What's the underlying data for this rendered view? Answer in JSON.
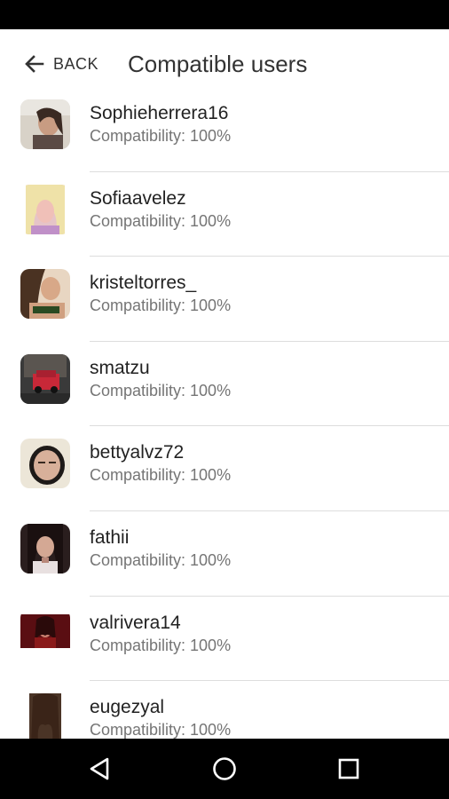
{
  "header": {
    "back_label": "BACK",
    "title": "Compatible users"
  },
  "users": [
    {
      "name": "Sophieherrera16",
      "compatibility": "Compatibility: 100%"
    },
    {
      "name": "Sofiaavelez",
      "compatibility": "Compatibility: 100%"
    },
    {
      "name": "kristeltorres_",
      "compatibility": "Compatibility: 100%"
    },
    {
      "name": "smatzu",
      "compatibility": "Compatibility: 100%"
    },
    {
      "name": "bettyalvz72",
      "compatibility": "Compatibility: 100%"
    },
    {
      "name": "fathii",
      "compatibility": "Compatibility: 100%"
    },
    {
      "name": "valrivera14",
      "compatibility": "Compatibility: 100%"
    },
    {
      "name": "eugezyal",
      "compatibility": "Compatibility: 100%"
    }
  ],
  "nav": {
    "back_icon": "triangle-back-icon",
    "home_icon": "circle-home-icon",
    "recents_icon": "square-recents-icon"
  },
  "colors": {
    "status_bar": "#000000",
    "nav_bar": "#000000",
    "text_primary": "#222222",
    "text_secondary": "#757575",
    "divider": "#dddddd"
  }
}
